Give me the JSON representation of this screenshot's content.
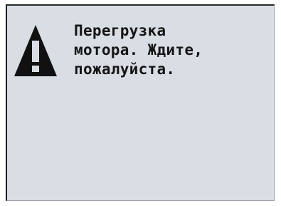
{
  "dialog": {
    "icon": "warning-icon",
    "message_lines": [
      "Перегрузка",
      "мотора. Ждите,",
      "пожалуйста."
    ]
  },
  "colors": {
    "screen_background": "#d9dde4",
    "text": "#151515",
    "icon": "#111111"
  }
}
